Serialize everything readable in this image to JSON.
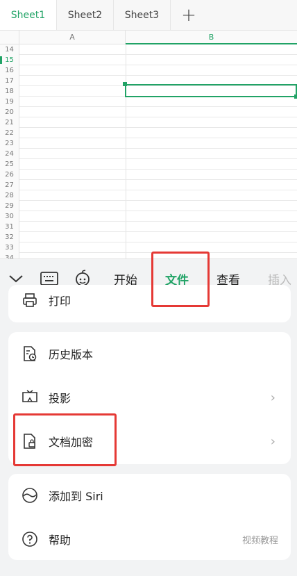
{
  "sheet_tabs": [
    {
      "label": "Sheet1",
      "active": true
    },
    {
      "label": "Sheet2",
      "active": false
    },
    {
      "label": "Sheet3",
      "active": false
    }
  ],
  "add_tab_symbol": "+",
  "grid": {
    "columns": [
      "A",
      "B"
    ],
    "rows": [
      "14",
      "15",
      "16",
      "17",
      "18",
      "19",
      "20",
      "21",
      "22",
      "23",
      "24",
      "25",
      "26",
      "27",
      "28",
      "29",
      "30",
      "31",
      "32",
      "33",
      "34"
    ],
    "active_row": "15",
    "active_column": "B",
    "accent_color": "#21a366"
  },
  "toolbar": {
    "icons": [
      "chevron-down-icon",
      "keyboard-icon",
      "assistant-icon"
    ],
    "menus": [
      "开始",
      "文件",
      "查看",
      "插入"
    ],
    "active_menu": "文件"
  },
  "file_panel": {
    "print_label": "打印",
    "group1": [
      {
        "label": "历史版本",
        "icon": "history-doc-icon"
      },
      {
        "label": "投影",
        "icon": "projection-icon",
        "chevron": "›"
      },
      {
        "label": "文档加密",
        "icon": "lock-doc-icon",
        "chevron": "›"
      }
    ],
    "group2": [
      {
        "label": "添加到 Siri",
        "icon": "siri-icon"
      },
      {
        "label": "帮助",
        "icon": "help-icon",
        "extra": "视频教程"
      }
    ]
  },
  "highlight_color": "#e53935"
}
